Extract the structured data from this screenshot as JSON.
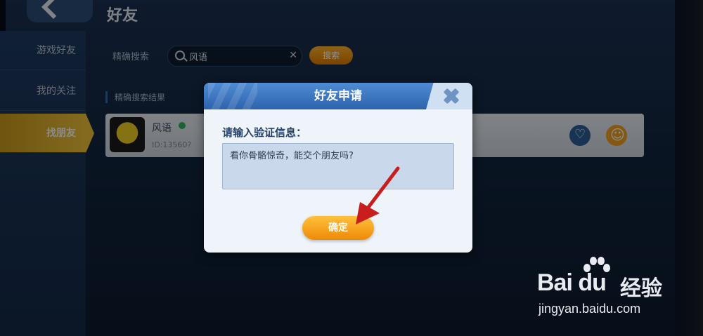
{
  "header": {
    "title": "好友"
  },
  "sidebar": {
    "items": [
      {
        "label": "游戏好友"
      },
      {
        "label": "我的关注"
      },
      {
        "label": "找朋友"
      }
    ]
  },
  "search": {
    "label": "精确搜索",
    "value": "风语",
    "button_label": "搜索"
  },
  "results": {
    "title": "精确搜索结果",
    "items": [
      {
        "name": "风语",
        "id": "ID:13560?"
      }
    ]
  },
  "dialog": {
    "title": "好友申请",
    "prompt": "请输入验证信息：",
    "message": "看你骨骼惊奇，能交个朋友吗?",
    "confirm_label": "确定"
  },
  "watermark": {
    "logo_text": "Bai du",
    "logo_cn": "经验",
    "url": "jingyan.baidu.com"
  },
  "colors": {
    "accent": "#f0a020",
    "dialog_header": "#2e63ae",
    "arrow": "#c81e1e"
  }
}
